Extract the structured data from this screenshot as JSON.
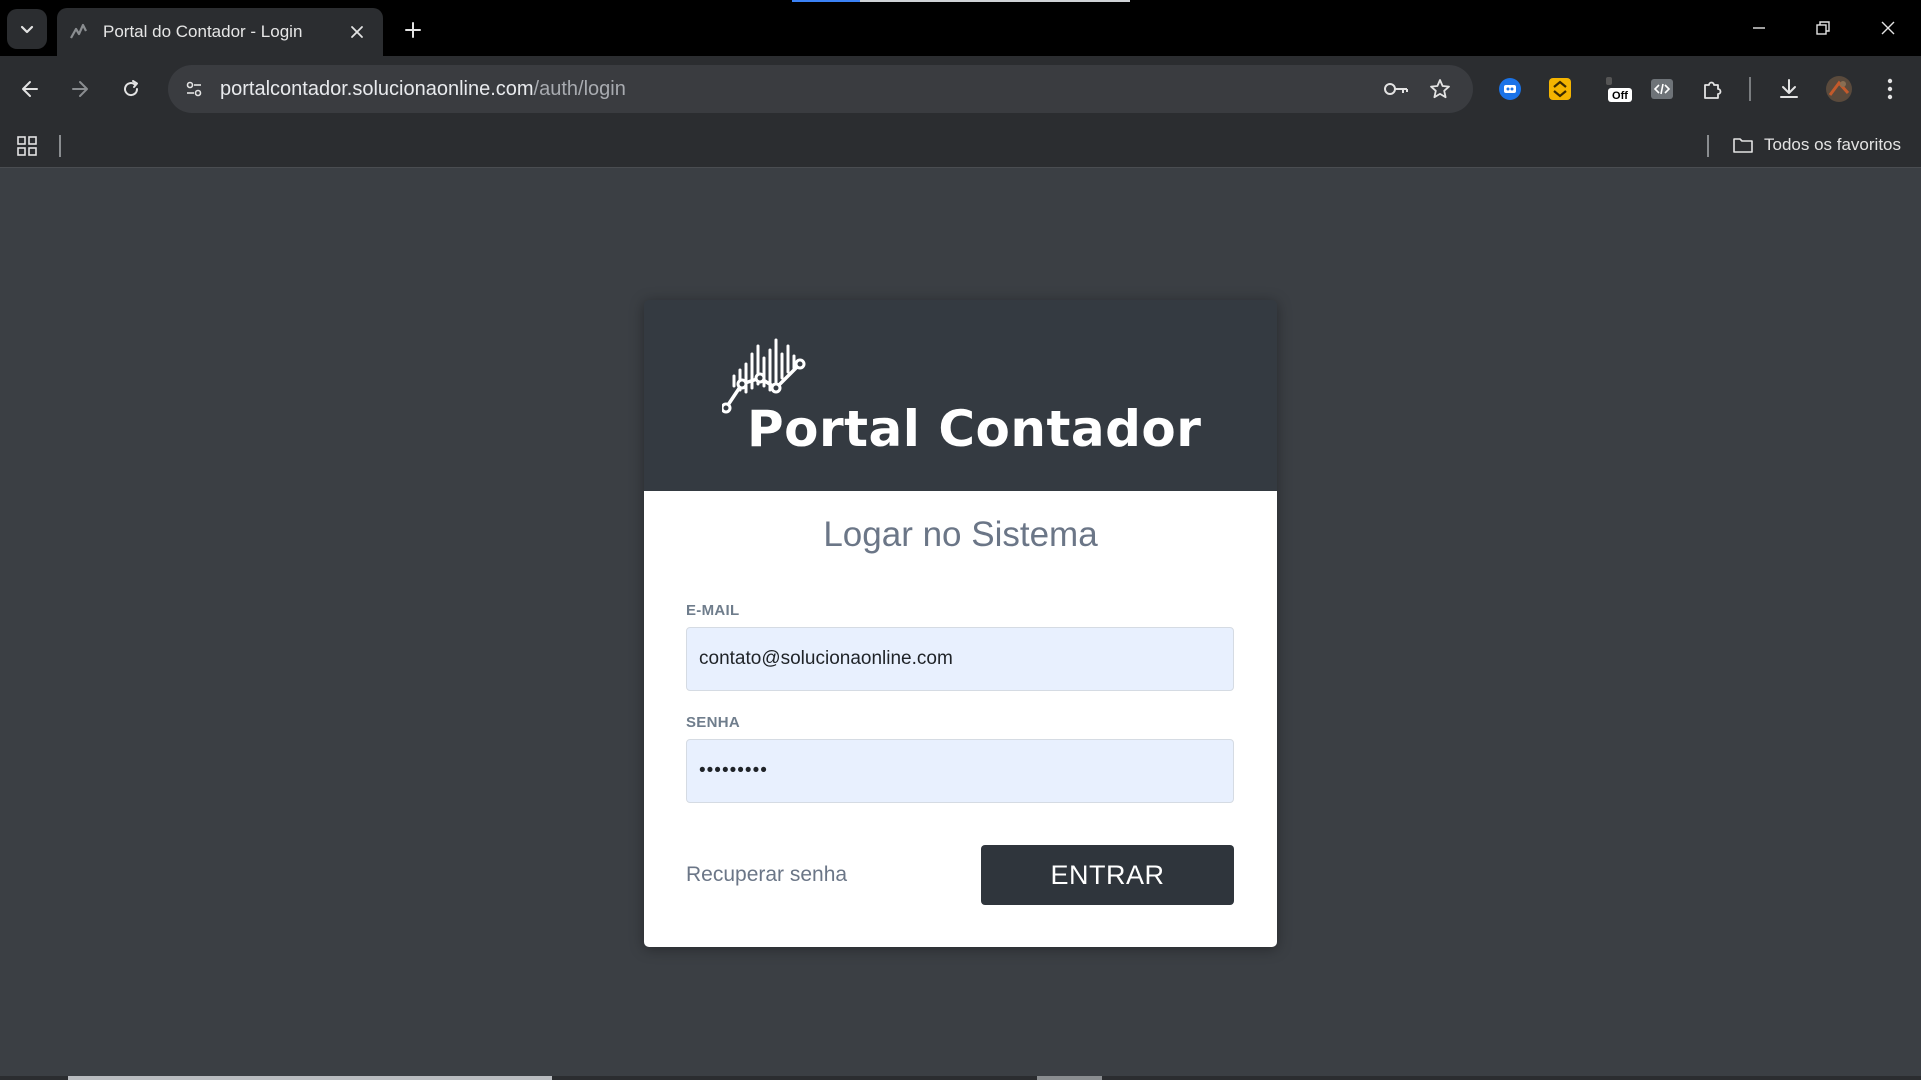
{
  "browser": {
    "tab_title": "Portal do Contador - Login",
    "url_host": "portalcontador.solucionaonline.com",
    "url_path": "/auth/login",
    "bookmarks_folder_label": "Todos os favoritos",
    "extension_off_badge": "Off"
  },
  "login": {
    "brand_name": "Portal Contador",
    "title": "Logar no Sistema",
    "email_label": "E-MAIL",
    "email_value": "contato@solucionaonline.com",
    "password_label": "SENHA",
    "password_value": "•••••••••",
    "recover_link": "Recuperar senha",
    "submit_label": "ENTRAR"
  },
  "colors": {
    "header_bg": "#343a41",
    "page_bg": "#3b3f44",
    "input_bg": "#e8f0fe",
    "button_bg": "#2f353c"
  }
}
